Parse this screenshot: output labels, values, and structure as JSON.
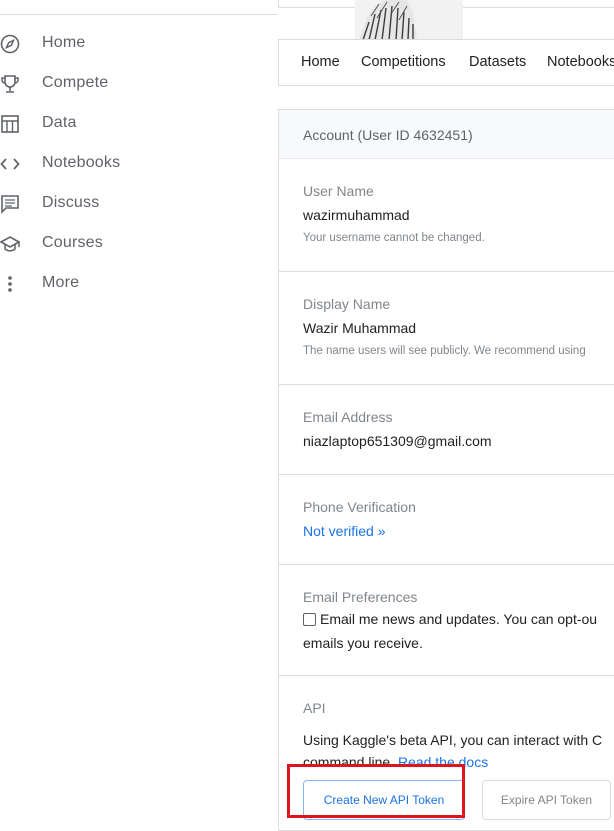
{
  "sidebar": {
    "items": [
      {
        "label": "Home",
        "icon": "compass-icon"
      },
      {
        "label": "Compete",
        "icon": "trophy-icon"
      },
      {
        "label": "Data",
        "icon": "table-icon"
      },
      {
        "label": "Notebooks",
        "icon": "code-icon"
      },
      {
        "label": "Discuss",
        "icon": "comment-icon"
      },
      {
        "label": "Courses",
        "icon": "graduation-cap-icon"
      },
      {
        "label": "More",
        "icon": "more-vertical-icon"
      }
    ]
  },
  "profile_tabs": [
    "Home",
    "Competitions",
    "Datasets",
    "Notebooks"
  ],
  "account": {
    "title": "Account (User ID 4632451)",
    "username": {
      "label": "User Name",
      "value": "wazirmuhammad",
      "help": "Your username cannot be changed."
    },
    "display_name": {
      "label": "Display Name",
      "value": "Wazir Muhammad",
      "help": "The name users will see publicly. We recommend using"
    },
    "email": {
      "label": "Email Address",
      "value": "niazlaptop651309@gmail.com"
    },
    "phone": {
      "label": "Phone Verification",
      "status_link": "Not verified »"
    },
    "email_prefs": {
      "label": "Email Preferences",
      "checkbox_text": "Email me news and updates. You can opt-ou",
      "checkbox_text_line2": "emails you receive.",
      "checked": false
    },
    "api": {
      "label": "API",
      "description_line1": "Using Kaggle's beta API, you can interact with C",
      "description_line2_prefix": "command line. ",
      "docs_link": "Read the docs",
      "create_button": "Create New API Token",
      "expire_button": "Expire API Token"
    }
  },
  "colors": {
    "link": "#1a73e8",
    "highlight_box": "#e0141e",
    "muted_text": "#80868b"
  }
}
